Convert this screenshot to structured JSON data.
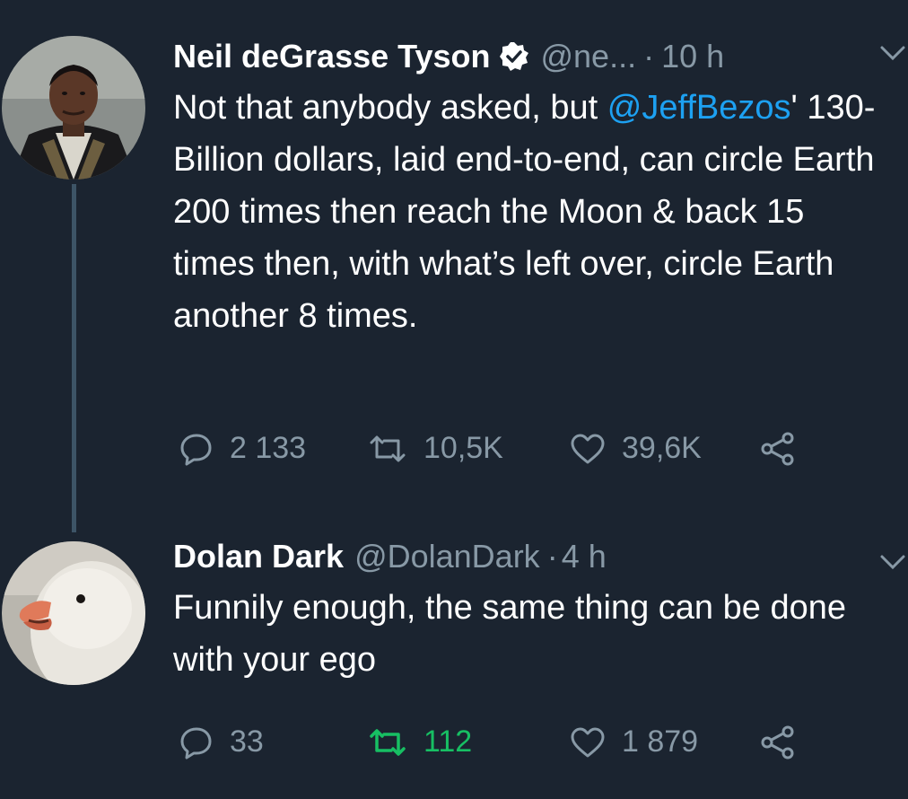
{
  "tweets": [
    {
      "author_name": "Neil deGrasse Tyson",
      "verified": true,
      "handle": "@ne...",
      "separator": "·",
      "time": "10 h",
      "text_before": "Not that anybody asked, but ",
      "mention": "@JeffBezos",
      "text_after": "' 130-Billion dollars, laid end-to-end, can circle Earth 200 times then reach the Moon & back 15 times then, with what’s left over, circle Earth another 8 times.",
      "replies": "2 133",
      "retweets": "10,5K",
      "likes": "39,6K"
    },
    {
      "author_name": "Dolan Dark",
      "handle": "@DolanDark",
      "separator": "·",
      "time": "4 h",
      "text": "Funnily enough, the same thing can be done with your ego",
      "replies": "33",
      "retweets": "112",
      "likes": "1 879",
      "retweeted": true
    }
  ],
  "colors": {
    "background": "#1b2430",
    "text": "#ffffff",
    "secondary": "#8899a6",
    "link": "#1da1f2",
    "retweet_active": "#17bf63"
  },
  "icons": {
    "reply": "reply-icon",
    "retweet": "retweet-icon",
    "like": "heart-icon",
    "share": "share-icon",
    "verified": "verified-badge-icon",
    "menu": "chevron-down-icon"
  }
}
